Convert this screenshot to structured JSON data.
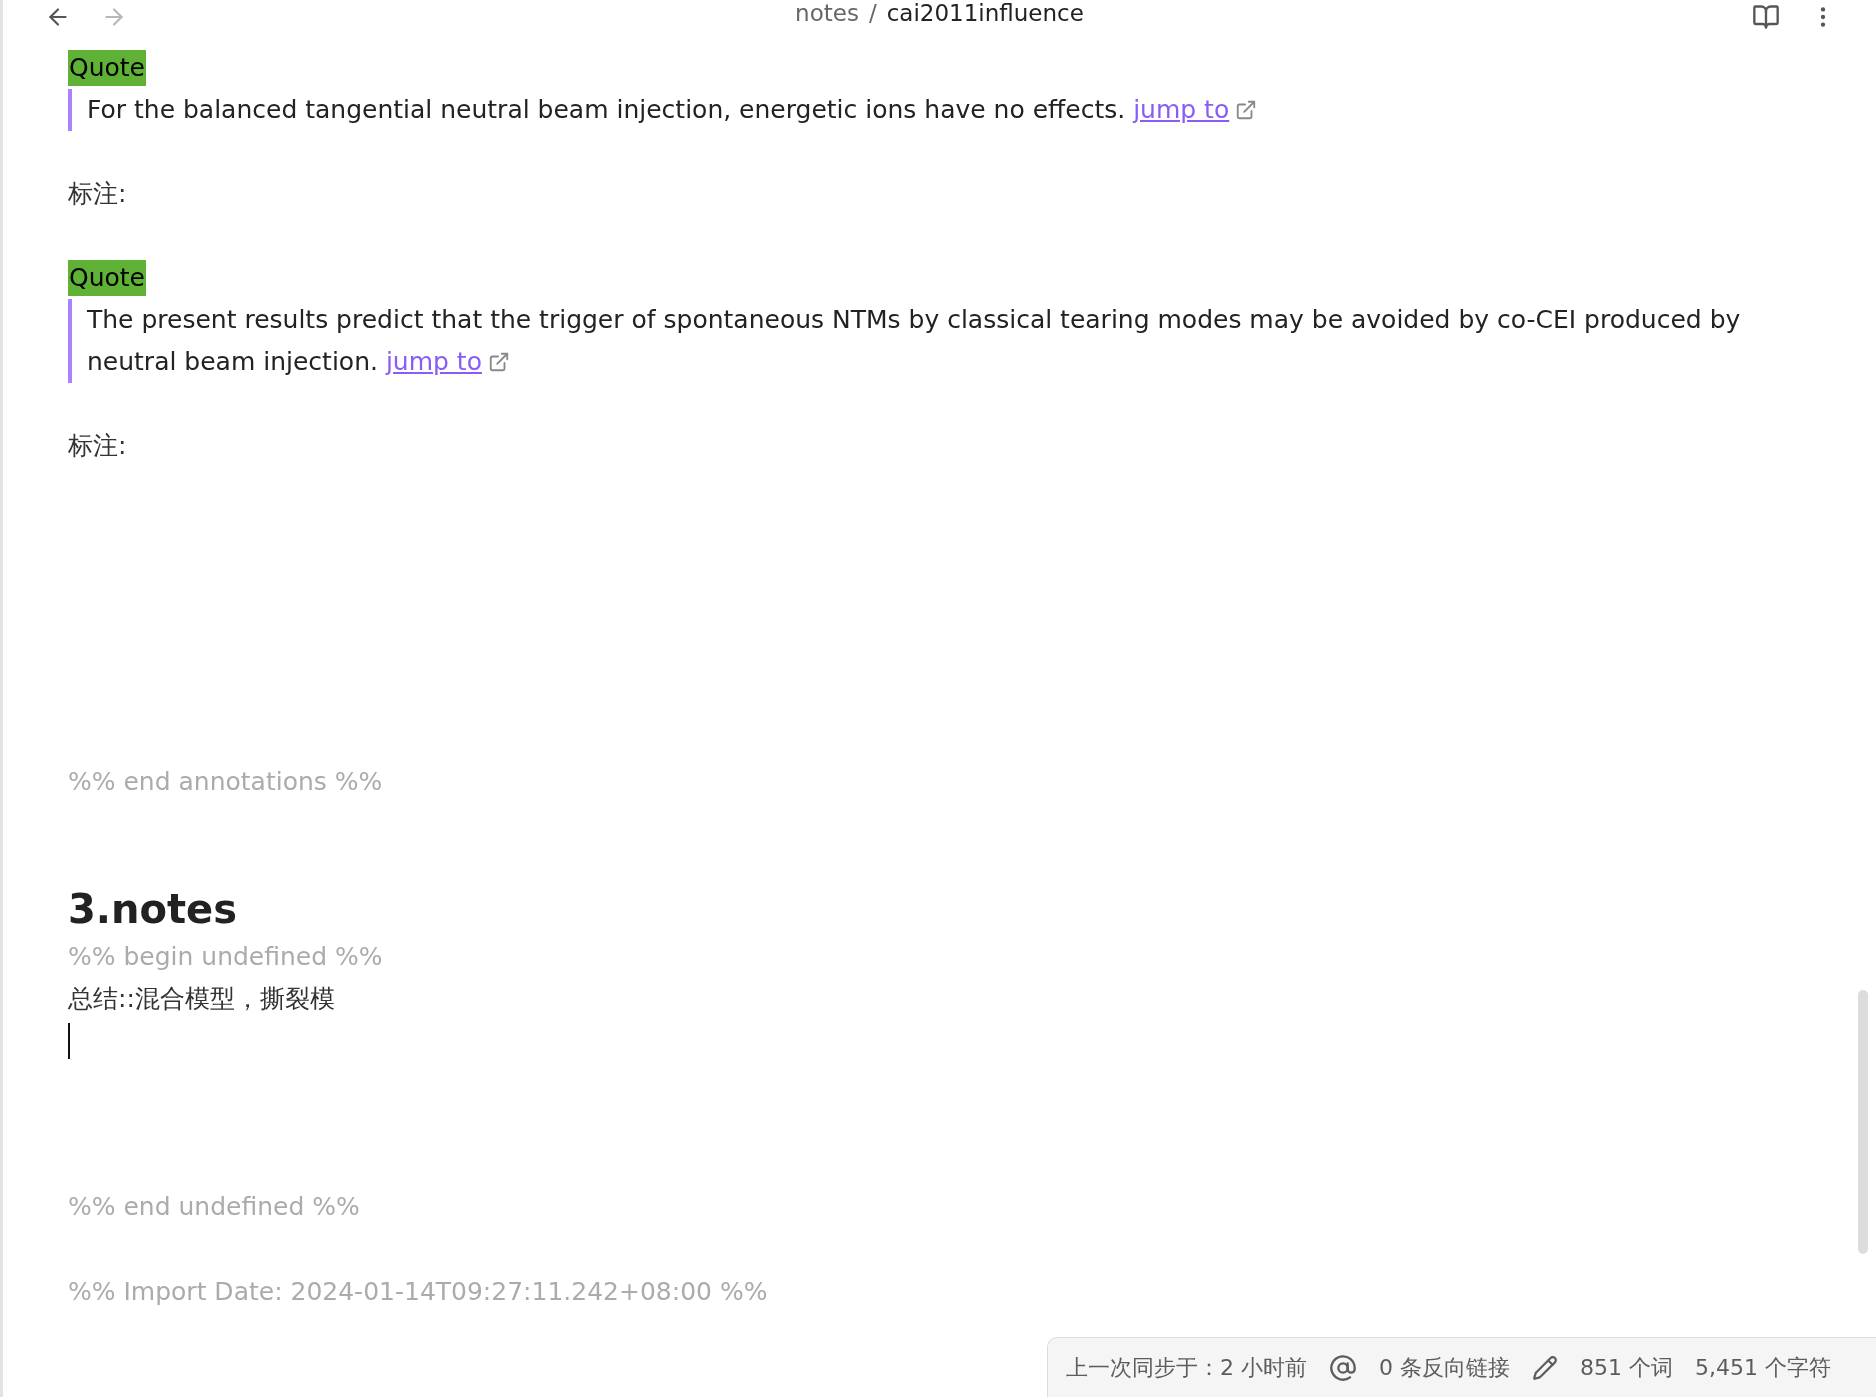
{
  "header": {
    "nav": [
      {
        "kind": "back",
        "disabled": false
      },
      {
        "kind": "forward",
        "disabled": true
      }
    ],
    "breadcrumb": {
      "folder": "notes",
      "separator": "/",
      "file": "cai2011influence"
    }
  },
  "blocks": [
    {
      "kind": "callout",
      "text": "Quote"
    },
    {
      "kind": "quote",
      "text": "For the balanced tangential neutral beam injection, energetic ions have no effects.",
      "link": "jump to"
    },
    {
      "kind": "label",
      "text": "标注:"
    },
    {
      "kind": "callout",
      "text": "Quote"
    },
    {
      "kind": "quote",
      "text": "The present results predict that the trigger of spontaneous NTMs by classical tearing modes may be avoided by co-CEI produced by neutral beam injection.",
      "link": "jump to"
    },
    {
      "kind": "label",
      "text": "标注:"
    },
    {
      "kind": "comment",
      "text": "%% end annotations %%"
    },
    {
      "kind": "heading",
      "text": "3.notes"
    },
    {
      "kind": "comment",
      "text": "%% begin undefined %%"
    },
    {
      "kind": "label",
      "text": "总结::混合模型，撕裂模"
    },
    {
      "kind": "cursor"
    },
    {
      "kind": "comment",
      "text": "%% end undefined %%"
    },
    {
      "kind": "comment",
      "text": "%% Import Date: 2024-01-14T09:27:11.242+08:00 %%"
    }
  ],
  "status_bar": [
    {
      "kind": "text",
      "text": "上一次同步于：2 小时前"
    },
    {
      "kind": "backlinks",
      "text": "0 条反向链接"
    },
    {
      "kind": "words",
      "text": "851 个词"
    },
    {
      "kind": "text",
      "text": "5,451 个字符"
    }
  ]
}
